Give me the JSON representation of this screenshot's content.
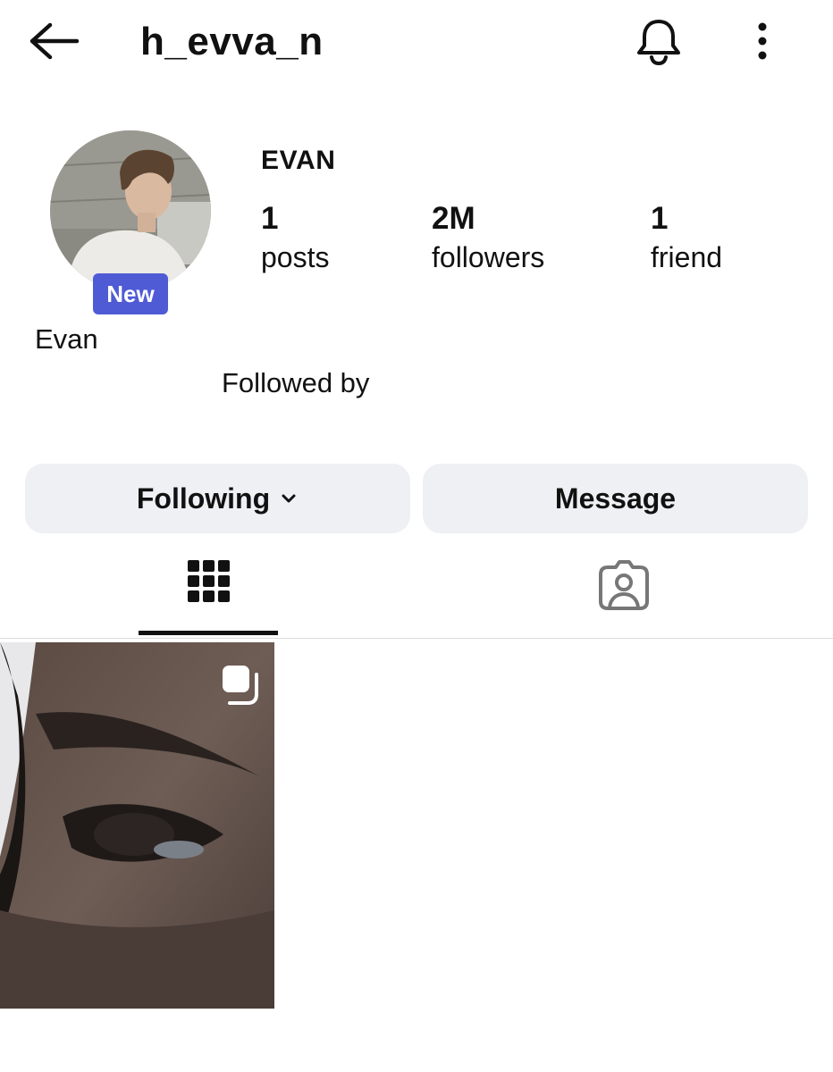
{
  "header": {
    "username": "h_evva_n",
    "back_icon": "arrow-left-icon",
    "bell_icon": "bell-icon",
    "more_icon": "more-vertical-icon"
  },
  "profile": {
    "display_name": "EVAN",
    "badge": "New",
    "bio_name": "Evan",
    "followed_by": "Followed by",
    "stats": [
      {
        "value": "1",
        "label": "posts"
      },
      {
        "value": "2M",
        "label": "followers"
      },
      {
        "value": "1",
        "label": "friend"
      }
    ]
  },
  "actions": {
    "following_label": "Following",
    "message_label": "Message"
  },
  "tabs": [
    {
      "icon": "grid-icon",
      "selected": true
    },
    {
      "icon": "tagged-user-icon",
      "selected": false
    }
  ],
  "colors": {
    "badge": "#4f5bd5",
    "button_bg": "#eff0f4",
    "divider": "#dbdbdb"
  },
  "posts": [
    {
      "type": "carousel",
      "icon": "multiple-posts-icon"
    }
  ]
}
